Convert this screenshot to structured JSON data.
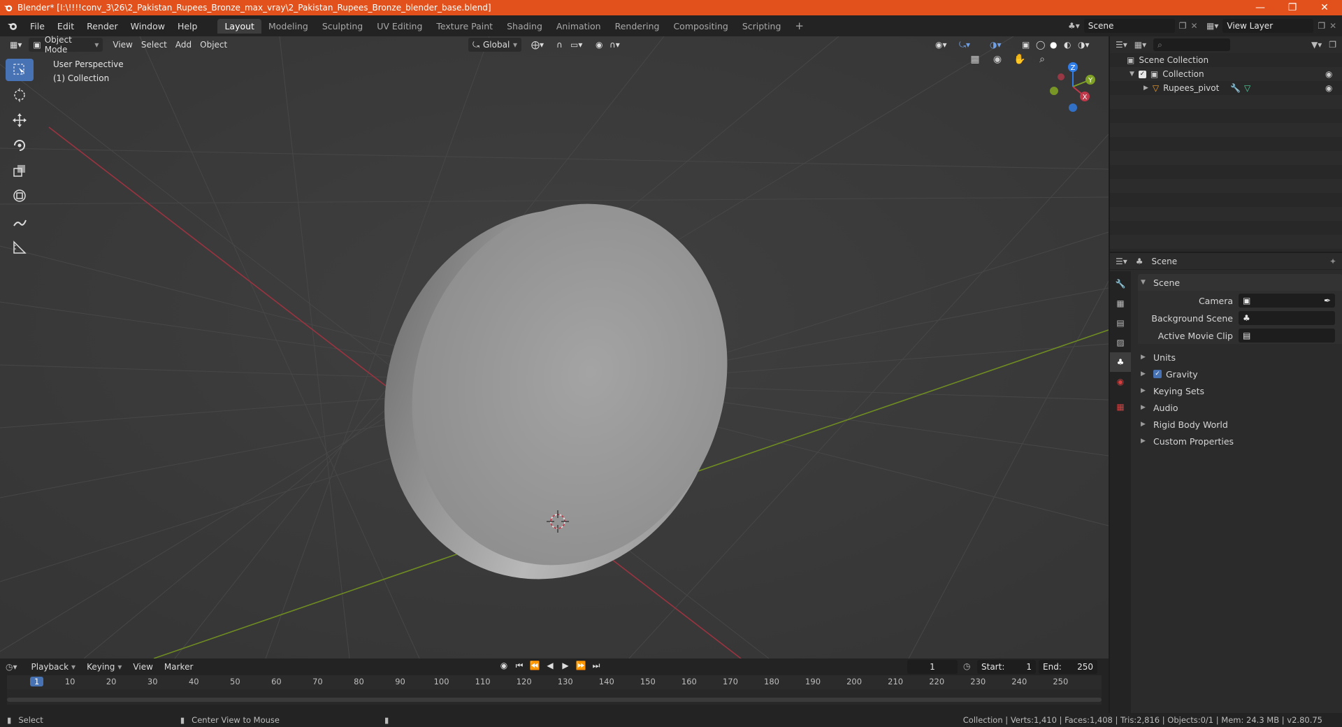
{
  "window": {
    "title": "Blender* [I:\\!!!!conv_3\\26\\2_Pakistan_Rupees_Bronze_max_vray\\2_Pakistan_Rupees_Bronze_blender_base.blend]"
  },
  "menubar": {
    "menus": [
      "File",
      "Edit",
      "Render",
      "Window",
      "Help"
    ],
    "workspaces": [
      "Layout",
      "Modeling",
      "Sculpting",
      "UV Editing",
      "Texture Paint",
      "Shading",
      "Animation",
      "Rendering",
      "Compositing",
      "Scripting"
    ],
    "active_workspace": "Layout",
    "scene_name": "Scene",
    "view_layer": "View Layer"
  },
  "viewport": {
    "mode": "Object Mode",
    "menus": [
      "View",
      "Select",
      "Add",
      "Object"
    ],
    "transform_orientation": "Global",
    "overlay_line1": "User Perspective",
    "overlay_line2": "(1) Collection",
    "gizmo_axes": [
      "Z",
      "Y",
      "X"
    ]
  },
  "outliner": {
    "root": "Scene Collection",
    "collection": "Collection",
    "object": "Rupees_pivot"
  },
  "properties": {
    "header": "Scene",
    "section": "Scene",
    "fields": [
      {
        "label": "Camera",
        "value": ""
      },
      {
        "label": "Background Scene",
        "value": ""
      },
      {
        "label": "Active Movie Clip",
        "value": ""
      }
    ],
    "subpanels": [
      "Units",
      "Gravity",
      "Keying Sets",
      "Audio",
      "Rigid Body World",
      "Custom Properties"
    ]
  },
  "timeline": {
    "menus": [
      "Playback",
      "Keying",
      "View",
      "Marker"
    ],
    "current_frame": "1",
    "start_label": "Start:",
    "start": "1",
    "end_label": "End:",
    "end": "250",
    "ruler": [
      "1",
      "10",
      "20",
      "30",
      "40",
      "50",
      "60",
      "70",
      "80",
      "90",
      "100",
      "110",
      "120",
      "130",
      "140",
      "150",
      "160",
      "170",
      "180",
      "190",
      "200",
      "210",
      "220",
      "230",
      "240",
      "250"
    ]
  },
  "statusbar": {
    "left1": "Select",
    "left2": "Center View to Mouse",
    "right": "Collection | Verts:1,410 | Faces:1,408 | Tris:2,816 | Objects:0/1 | Mem: 24.3 MB | v2.80.75"
  },
  "colors": {
    "titlebar": "#e2511b",
    "accent": "#4772b3",
    "x_axis": "#c0394a",
    "y_axis": "#7fa125",
    "z_axis": "#2f7ee8"
  }
}
